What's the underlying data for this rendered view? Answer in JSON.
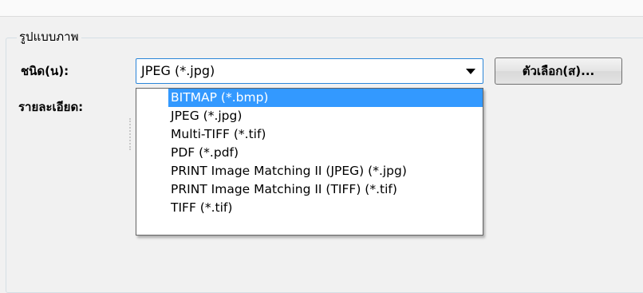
{
  "group": {
    "title": "รูปแบบภาพ"
  },
  "labels": {
    "type": "ชนิด(น):",
    "detail": "รายละเอียด:"
  },
  "combo": {
    "selected_value": "JPEG (*.jpg)"
  },
  "options_button": {
    "label": "ตัวเลือก(ส)..."
  },
  "dropdown": {
    "items": [
      {
        "label": "BITMAP (*.bmp)",
        "highlighted": true
      },
      {
        "label": "JPEG (*.jpg)",
        "highlighted": false
      },
      {
        "label": "Multi-TIFF (*.tif)",
        "highlighted": false
      },
      {
        "label": "PDF (*.pdf)",
        "highlighted": false
      },
      {
        "label": "PRINT Image Matching II (JPEG) (*.jpg)",
        "highlighted": false
      },
      {
        "label": "PRINT Image Matching II (TIFF) (*.tif)",
        "highlighted": false
      },
      {
        "label": "TIFF (*.tif)",
        "highlighted": false
      }
    ]
  },
  "colors": {
    "highlight": "#3399ff",
    "combo_border": "#2a85d8",
    "window_background": "#f1f1f1"
  }
}
